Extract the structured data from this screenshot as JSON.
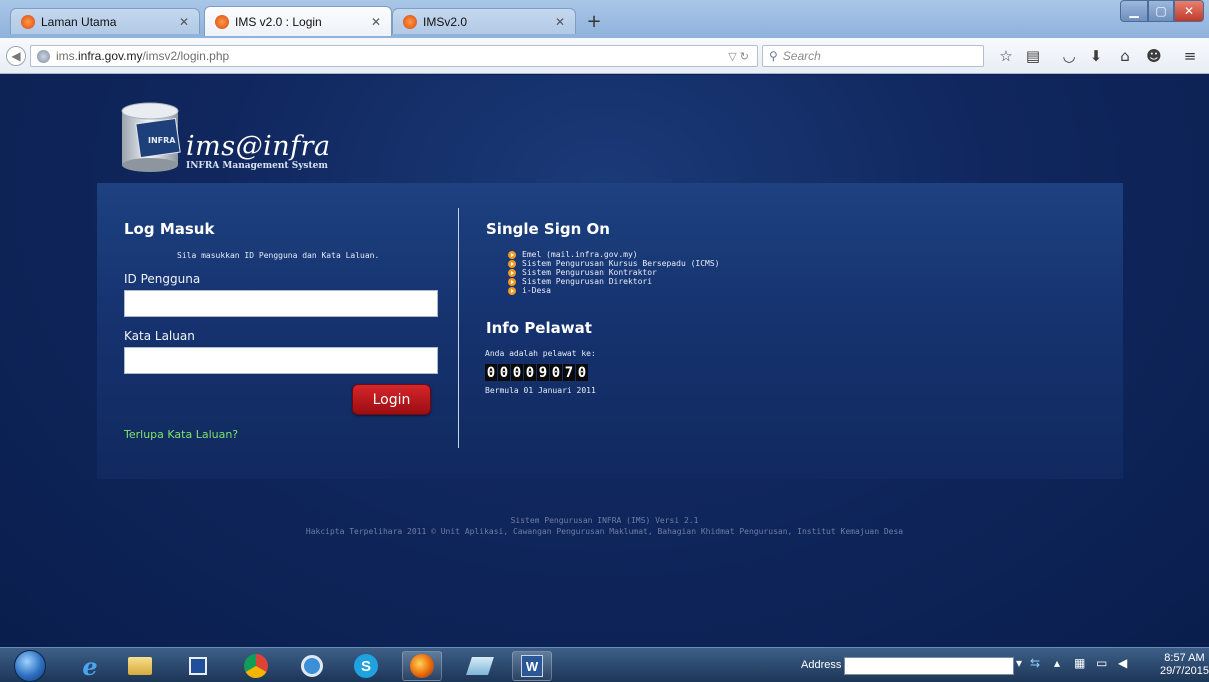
{
  "browser": {
    "tabs": [
      {
        "label": "Laman Utama",
        "active": false
      },
      {
        "label": "IMS v2.0 : Login",
        "active": true
      },
      {
        "label": "IMSv2.0",
        "active": false
      }
    ],
    "url_prefix": "ims.",
    "url_domain": "infra.gov.my",
    "url_path": "/imsv2/login.php",
    "search_placeholder": "Search"
  },
  "logo": {
    "script": "ims@infra",
    "subtitle": "INFRA Management System",
    "badge": "INFRA"
  },
  "login": {
    "heading": "Log Masuk",
    "instruction": "Sila masukkan ID Pengguna dan Kata Laluan.",
    "username_label": "ID Pengguna",
    "username_value": "",
    "password_label": "Kata Laluan",
    "password_value": "",
    "button": "Login",
    "forgot": "Terlupa Kata Laluan?"
  },
  "sso": {
    "heading": "Single Sign On",
    "links": [
      "Emel (mail.infra.gov.my)",
      "Sistem Pengurusan Kursus Bersepadu (ICMS)",
      "Sistem Pengurusan Kontraktor",
      "Sistem Pengurusan Direktori",
      "i-Desa"
    ]
  },
  "visitor": {
    "heading": "Info Pelawat",
    "intro": "Anda adalah pelawat ke:",
    "digits": [
      "0",
      "0",
      "0",
      "0",
      "9",
      "0",
      "7",
      "0"
    ],
    "since": "Bermula 01 Januari 2011"
  },
  "footer": {
    "line1": "Sistem Pengurusan INFRA (IMS) Versi 2.1",
    "line2": "Hakcipta Terpelihara 2011 © Unit Aplikasi, Cawangan Pengurusan Maklumat, Bahagian Khidmat Pengurusan, Institut Kemajuan Desa"
  },
  "taskbar": {
    "address_label": "Address",
    "time": "8:57 AM",
    "date": "29/7/2015",
    "word_label": "W"
  },
  "colors": {
    "page_bg": "#10275e",
    "login_button": "#c11a20",
    "forgot_link": "#7ee36a",
    "bullet": "#f39a20"
  }
}
